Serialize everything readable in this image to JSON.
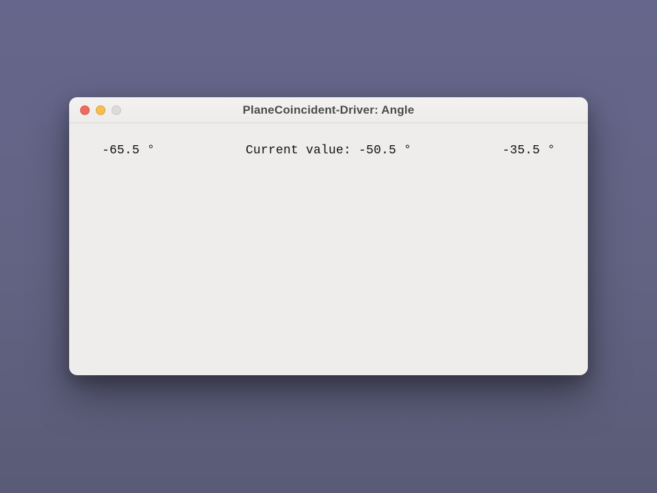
{
  "window": {
    "title": "PlaneCoincident-Driver: Angle"
  },
  "values": {
    "min": "-65.5 °",
    "current_label": "Current value: -50.5 °",
    "max": "-35.5 °"
  }
}
